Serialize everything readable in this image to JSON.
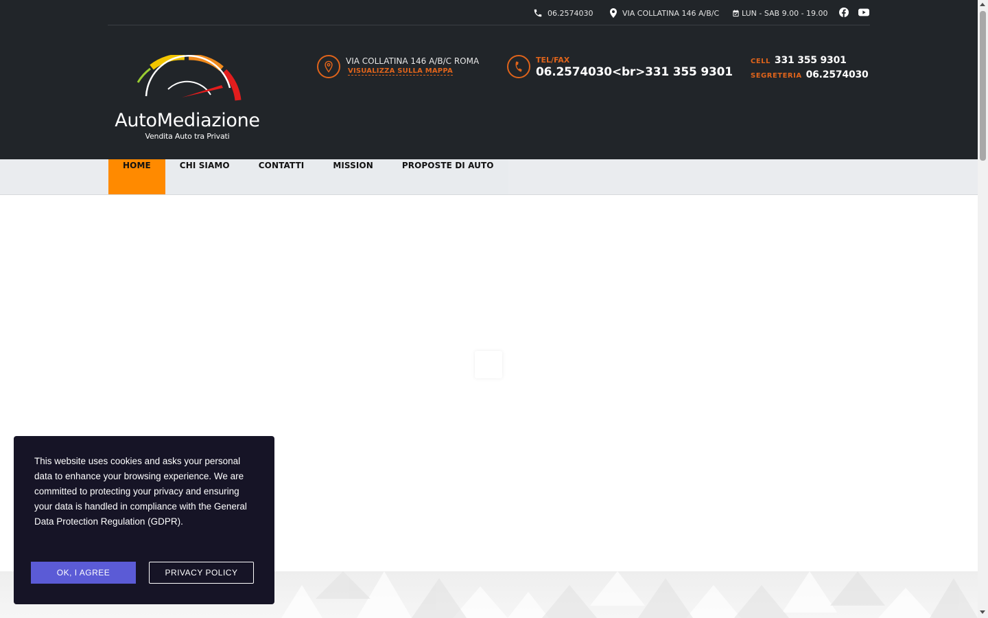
{
  "topbar": {
    "phone": "06.2574030",
    "address": "VIA COLLATINA 146 A/B/C",
    "hours": "LUN - SAB 9.00 - 19.00",
    "social": [
      "facebook-icon",
      "youtube-icon"
    ]
  },
  "logo": {
    "name": "AutoMediazione",
    "tagline": "Vendita Auto tra Privati"
  },
  "header_info": {
    "address": "VIA COLLATINA 146 A/B/C ROMA",
    "map_link": "VISUALIZZA SULLA MAPPA",
    "tel_label": "TEL/FAX",
    "tel_value": "06.2574030<br>331 355 9301",
    "cell_label": "CELL",
    "cell_value": "331 355 9301",
    "secretary_label": "SEGRETERIA",
    "secretary_value": "06.2574030"
  },
  "nav": {
    "items": [
      "HOME",
      "CHI SIAMO",
      "CONTATTI",
      "MISSION",
      "PROPOSTE DI AUTO"
    ],
    "active": "HOME"
  },
  "cookie": {
    "text": "This website uses cookies and asks your personal data to enhance your browsing experience. We are committed to protecting your privacy and ensuring your data is handled in compliance with the General Data Protection Regulation (GDPR).",
    "agree_label": "OK, I AGREE",
    "privacy_label": "PRIVACY POLICY"
  },
  "colors": {
    "header_bg": "#212529",
    "accent": "#e0641b",
    "nav_active": "#ff8a00",
    "cookie_bg": "#161426",
    "cookie_button": "#5b5bd6"
  }
}
